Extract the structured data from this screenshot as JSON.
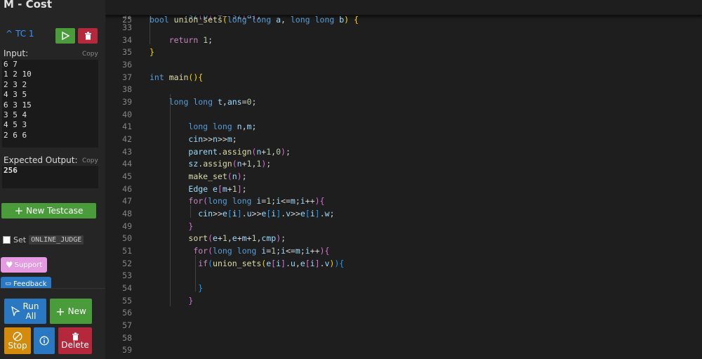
{
  "sidebar": {
    "title": "M - Cost",
    "testcase": {
      "label": "TC 1",
      "input_label": "Input:",
      "copy_label": "Copy",
      "input_lines": [
        "6 7",
        "1 2 10",
        "2 3 2",
        "4 3 5",
        "6 3 15",
        "3 5 4",
        "4 5 3",
        "2 6 6"
      ],
      "expected_label": "Expected Output:",
      "expected_value": "256"
    },
    "new_testcase_label": "New Testcase",
    "set_label": "Set",
    "online_judge_label": "ONLINE_JUDGE",
    "support_label": "Support",
    "feedback_label": "Feedback"
  },
  "bottom_bar": {
    "run_all_line1": "Run",
    "run_all_line2": "All",
    "new_label": "New",
    "stop_label": "Stop",
    "delete_label": "Delete"
  },
  "editor": {
    "sticky_line_number": "25",
    "line_numbers": [
      "32",
      "33",
      "34",
      "35",
      "36",
      "37",
      "38",
      "39",
      "40",
      "41",
      "42",
      "43",
      "44",
      "45",
      "46",
      "47",
      "48",
      "49",
      "50",
      "51",
      "52",
      "53",
      "54",
      "55",
      "56",
      "57",
      "58",
      "59"
    ]
  },
  "colors": {
    "keyword": "#569cd6",
    "control": "#c586c0",
    "function": "#dcdcaa",
    "variable": "#9cdcfe",
    "number": "#b5cea8",
    "bracket1": "#ffd700",
    "bracket2": "#da70d6",
    "bracket3": "#179fff",
    "green_button": "#4a9c3a",
    "red_button": "#b5273a",
    "blue_button": "#2b78c2",
    "orange_button": "#d48b0c"
  }
}
